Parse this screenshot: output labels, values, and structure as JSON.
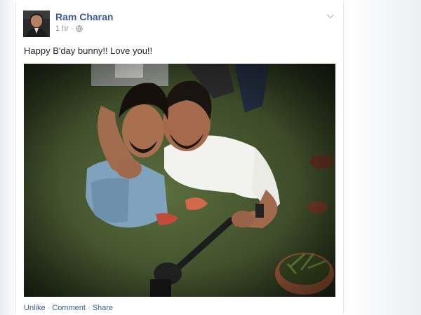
{
  "post": {
    "author": "Ram Charan",
    "time": "1 hr",
    "separator": "·",
    "privacy_icon": "globe-icon",
    "menu_icon": "chevron-down-icon",
    "message": "Happy B'day bunny!! Love you!!"
  },
  "actions": {
    "unlike": "Unlike",
    "comment": "Comment",
    "share": "Share",
    "separator": "·"
  },
  "colors": {
    "link": "#3b5998",
    "muted": "#90949c",
    "text": "#1d2129"
  }
}
